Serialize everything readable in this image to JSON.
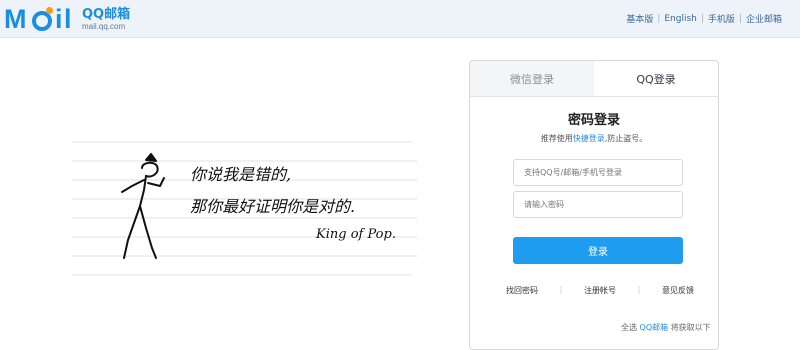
{
  "header": {
    "logo_title": "QQ邮箱",
    "logo_sub": "mail.qq.com",
    "links": [
      "基本版",
      "English",
      "手机版",
      "企业邮箱"
    ]
  },
  "illustration": {
    "line1": "你说我是错的,",
    "line2": "那你最好证明你是对的.",
    "signature": "King of Pop."
  },
  "login": {
    "tabs": [
      "微信登录",
      "QQ登录"
    ],
    "title": "密码登录",
    "hint_prefix": "推荐使用",
    "hint_link": "快捷登录",
    "hint_suffix": ",防止盗号。",
    "account_placeholder": "支持QQ号/邮箱/手机号登录",
    "password_placeholder": "请输入密码",
    "submit_label": "登录",
    "links": [
      "找回密码",
      "注册帐号",
      "意见反馈"
    ]
  },
  "footer": {
    "prefix": "全选",
    "link": "QQ邮箱",
    "suffix": "将获取以下"
  },
  "colors": {
    "accent": "#1e9df0",
    "header_bg": "#eef3fa",
    "brand": "#1a8ee0"
  }
}
